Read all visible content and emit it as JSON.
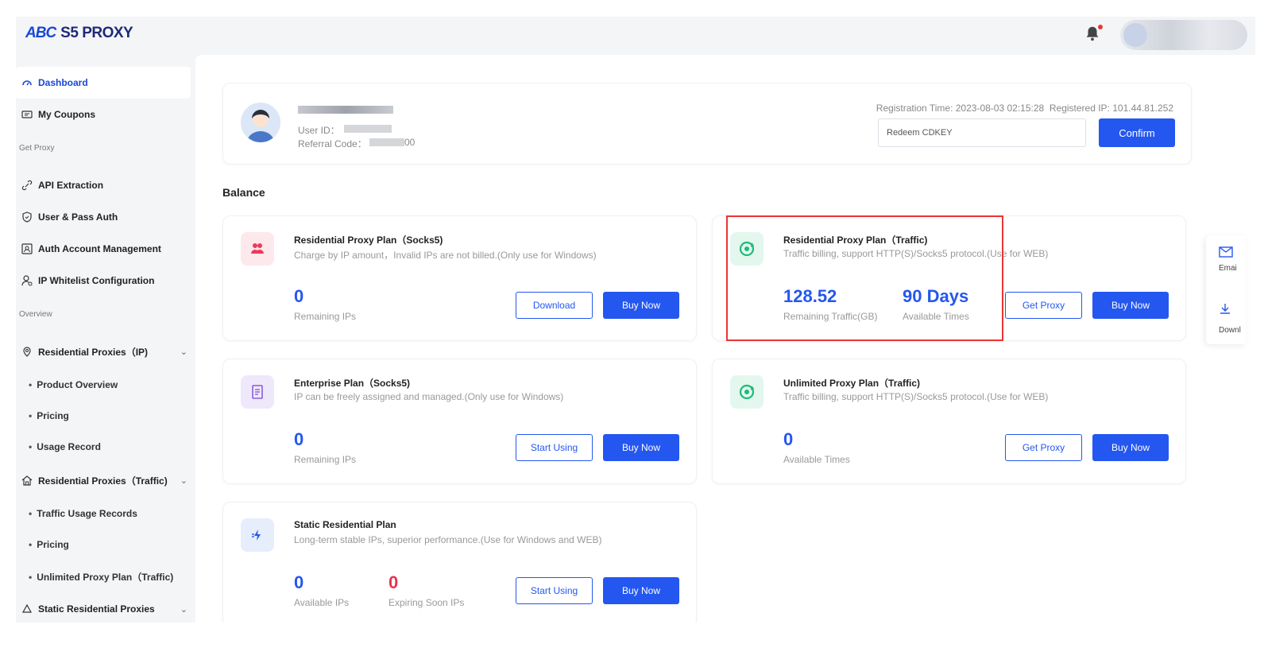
{
  "app": {
    "logo_mark": "ABC",
    "logo_text": "S5 PROXY"
  },
  "sidebar": {
    "dashboard": "Dashboard",
    "my_coupons": "My Coupons",
    "sec_get_proxy": "Get Proxy",
    "api_extraction": "API Extraction",
    "user_pass_auth": "User & Pass Auth",
    "auth_account_mgmt": "Auth Account Management",
    "ip_whitelist": "IP Whitelist Configuration",
    "sec_overview": "Overview",
    "res_ip": "Residential Proxies（IP)",
    "res_ip_items": [
      "Product Overview",
      "Pricing",
      "Usage Record"
    ],
    "res_traffic": "Residential Proxies（Traffic)",
    "res_traffic_items": [
      "Traffic Usage Records",
      "Pricing",
      "Unlimited Proxy Plan（Traffic)"
    ],
    "static_res": "Static Residential Proxies"
  },
  "profile": {
    "user_id_label": "User ID：",
    "referral_label": "Referral Code：",
    "referral_tail": "00",
    "registration_time_label": "Registration Time:",
    "registration_time": "2023-08-03 02:15:28",
    "registered_ip_label": "Registered IP:",
    "registered_ip": "101.44.81.252",
    "redeem_placeholder": "Redeem CDKEY",
    "confirm_label": "Confirm"
  },
  "balance_title": "Balance",
  "plans": {
    "res_socks5": {
      "title": "Residential Proxy Plan（Socks5)",
      "desc": "Charge by IP amount，Invalid IPs are not billed.(Only use for Windows)",
      "value": "0",
      "label": "Remaining IPs",
      "btn1": "Download",
      "btn2": "Buy Now"
    },
    "res_traffic": {
      "title": "Residential Proxy Plan（Traffic)",
      "desc": "Traffic billing, support HTTP(S)/Socks5 protocol.(Use for WEB)",
      "value1": "128.52",
      "label1": "Remaining Traffic(GB)",
      "value2": "90 Days",
      "label2": "Available Times",
      "btn1": "Get Proxy",
      "btn2": "Buy Now"
    },
    "enterprise": {
      "title": "Enterprise Plan（Socks5)",
      "desc": "IP can be freely assigned and managed.(Only use for Windows)",
      "value": "0",
      "label": "Remaining IPs",
      "btn1": "Start Using",
      "btn2": "Buy Now"
    },
    "unlimited": {
      "title": "Unlimited Proxy Plan（Traffic)",
      "desc": "Traffic billing, support HTTP(S)/Socks5 protocol.(Use for WEB)",
      "value": "0",
      "label": "Available Times",
      "btn1": "Get Proxy",
      "btn2": "Buy Now"
    },
    "static_res": {
      "title": "Static Residential Plan",
      "desc": "Long-term stable IPs, superior performance.(Use for Windows and WEB)",
      "value1": "0",
      "label1": "Available IPs",
      "value2": "0",
      "label2": "Expiring Soon IPs",
      "btn1": "Start Using",
      "btn2": "Buy Now"
    }
  },
  "floater": {
    "email": "Emai",
    "download": "Downl"
  },
  "colors": {
    "primary": "#2457f0",
    "highlight": "#e33333",
    "danger": "#e8344e"
  }
}
